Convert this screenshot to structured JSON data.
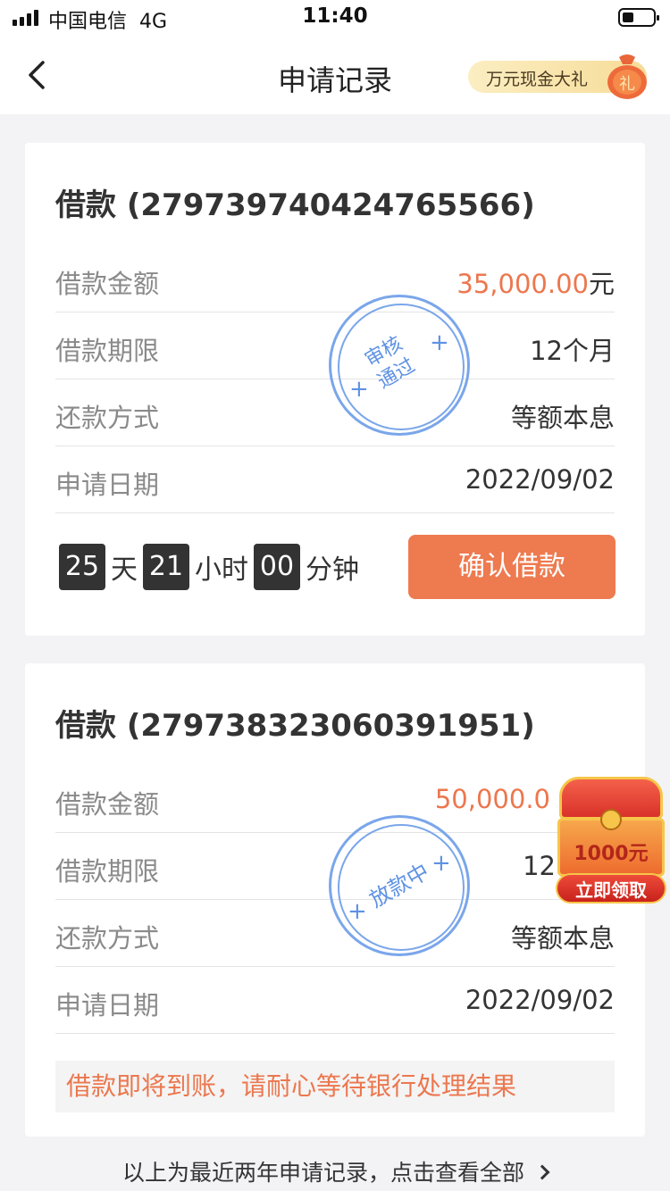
{
  "status_bar": {
    "carrier": "中国电信",
    "network": "4G",
    "time": "11:40"
  },
  "nav": {
    "title": "申请记录",
    "promo_label": "万元现金大礼",
    "promo_badge": "礼"
  },
  "records": [
    {
      "title": "借款 (279739740424765566)",
      "rows": [
        {
          "label": "借款金额",
          "value": "35,000.00",
          "unit": "元"
        },
        {
          "label": "借款期限",
          "value": "12个月"
        },
        {
          "label": "还款方式",
          "value": "等额本息"
        },
        {
          "label": "申请日期",
          "value": "2022/09/02"
        }
      ],
      "stamp": {
        "line1": "审核",
        "line2": "通过"
      },
      "countdown": {
        "days": "25",
        "days_unit": "天",
        "hours": "21",
        "hours_unit": "小时",
        "minutes": "00",
        "minutes_unit": "分钟"
      },
      "action_label": "确认借款"
    },
    {
      "title": "借款 (279738323060391951)",
      "rows": [
        {
          "label": "借款金额",
          "value": "50,000.0"
        },
        {
          "label": "借款期限",
          "value": "12"
        },
        {
          "label": "还款方式",
          "value": "等额本息"
        },
        {
          "label": "申请日期",
          "value": "2022/09/02"
        }
      ],
      "stamp": {
        "line1": "放款中"
      },
      "notice": "借款即将到账，请耐心等待银行处理结果"
    }
  ],
  "floating_gift": {
    "amount": "1000元",
    "button_label": "立即领取"
  },
  "footer": {
    "text": "以上为最近两年申请记录，点击查看全部"
  },
  "colors": {
    "accent": "#ee7a50",
    "amount": "#ec774e",
    "stamp": "#5f92e3"
  }
}
